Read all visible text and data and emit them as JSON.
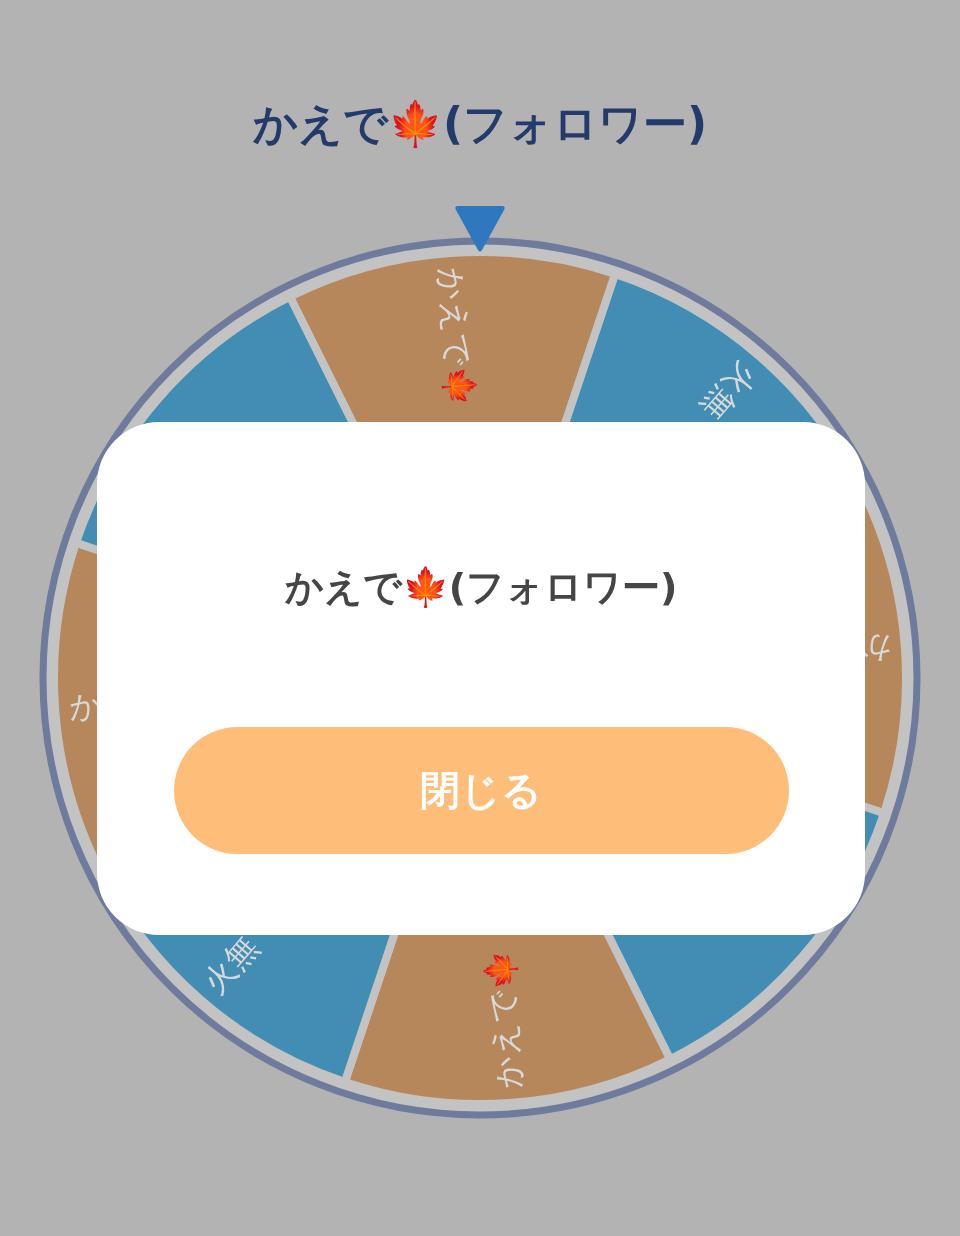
{
  "title": "かえで🍁(フォロワー)",
  "wheel": {
    "segments": [
      {
        "label": "かえで🍁",
        "color": "#b5875a"
      },
      {
        "label": "火無",
        "color": "#418db4"
      },
      {
        "label": "か",
        "color": "#b5875a"
      },
      {
        "color": "#418db4"
      },
      {
        "label": "かえで🍁",
        "color": "#b5875a"
      },
      {
        "label": "火無",
        "color": "#418db4"
      },
      {
        "label": "か",
        "color": "#b5875a"
      },
      {
        "color": "#418db4"
      }
    ]
  },
  "dialog": {
    "result": "かえで🍁(フォロワー)",
    "button": "閉じる"
  }
}
